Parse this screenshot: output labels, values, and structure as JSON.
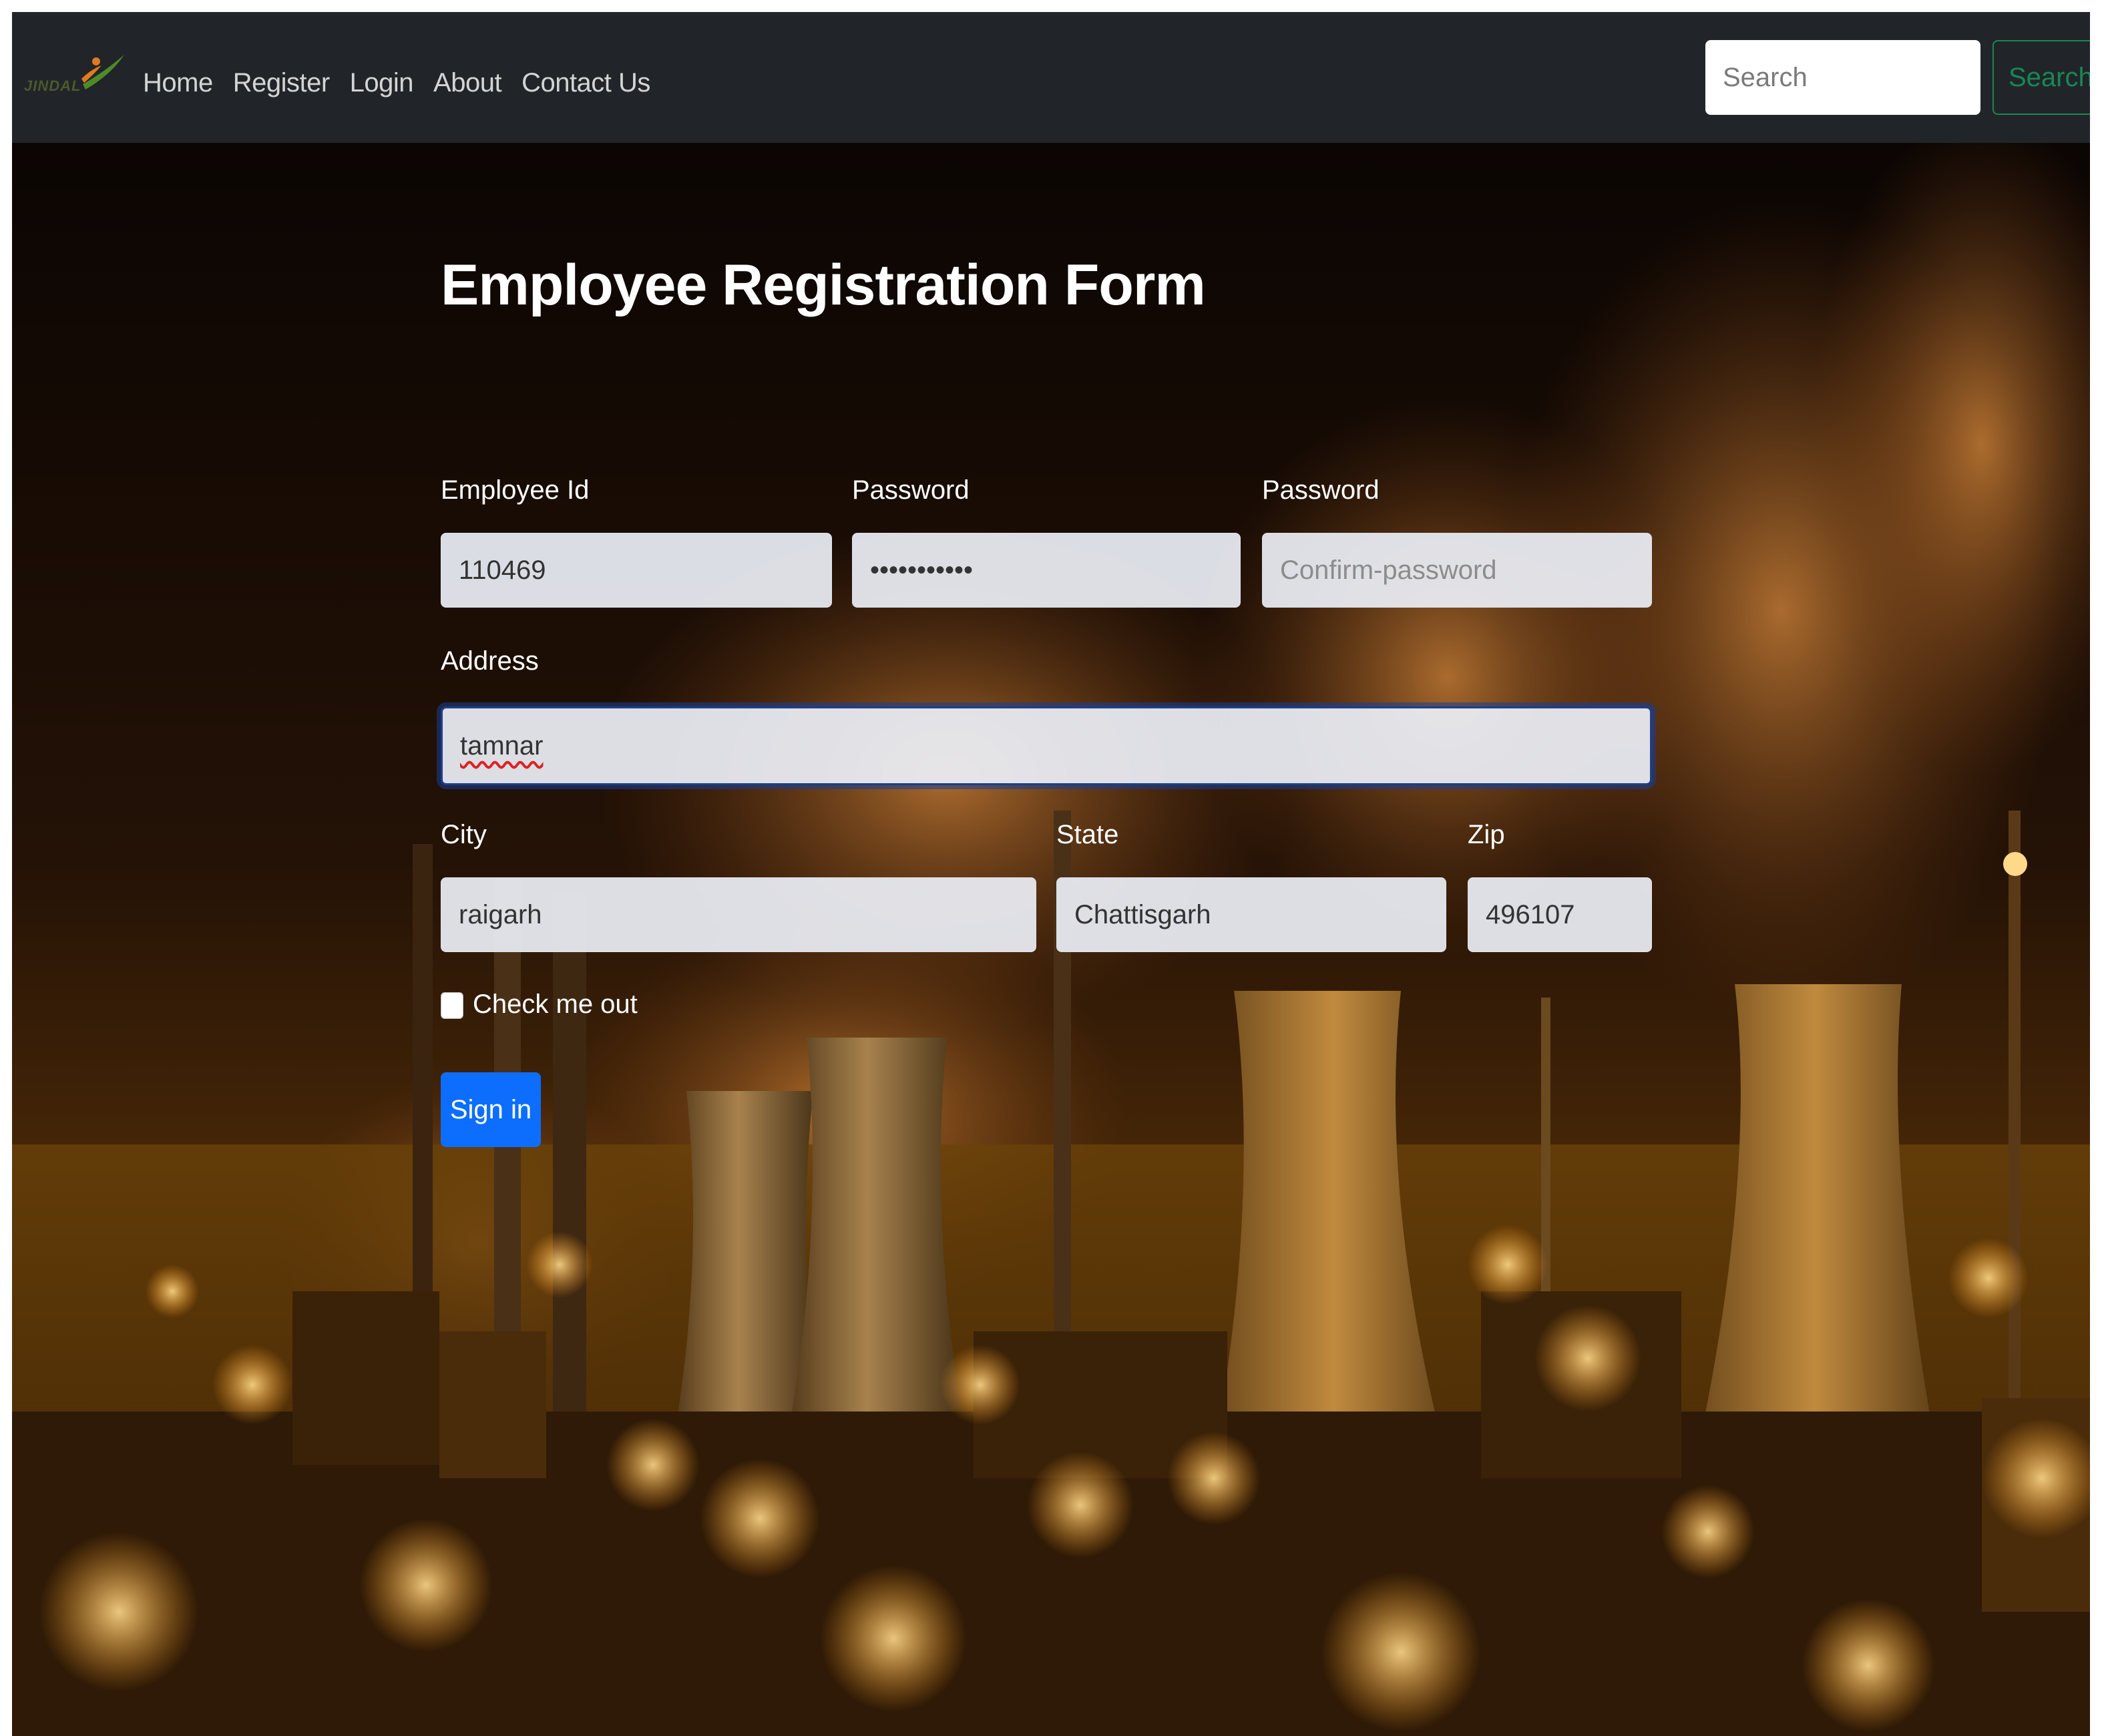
{
  "navbar": {
    "brand": "JINDAL",
    "links": [
      "Home",
      "Register",
      "Login",
      "About",
      "Contact Us"
    ],
    "search_placeholder": "Search",
    "search_button": "Search"
  },
  "form": {
    "title": "Employee Registration Form",
    "employee_id": {
      "label": "Employee Id",
      "value": "110469"
    },
    "password": {
      "label": "Password",
      "value": "•••••••••••"
    },
    "confirm_password": {
      "label": "Password",
      "placeholder": "Confirm-password"
    },
    "address": {
      "label": "Address",
      "value": "tamnar"
    },
    "city": {
      "label": "City",
      "value": "raigarh"
    },
    "state": {
      "label": "State",
      "value": "Chattisgarh"
    },
    "zip": {
      "label": "Zip",
      "value": "496107"
    },
    "checkbox_label": "Check me out",
    "checkbox_checked": false,
    "submit": "Sign in"
  },
  "colors": {
    "navbar_bg": "#212529",
    "primary_button": "#0d6efd",
    "search_button": "#198754"
  }
}
